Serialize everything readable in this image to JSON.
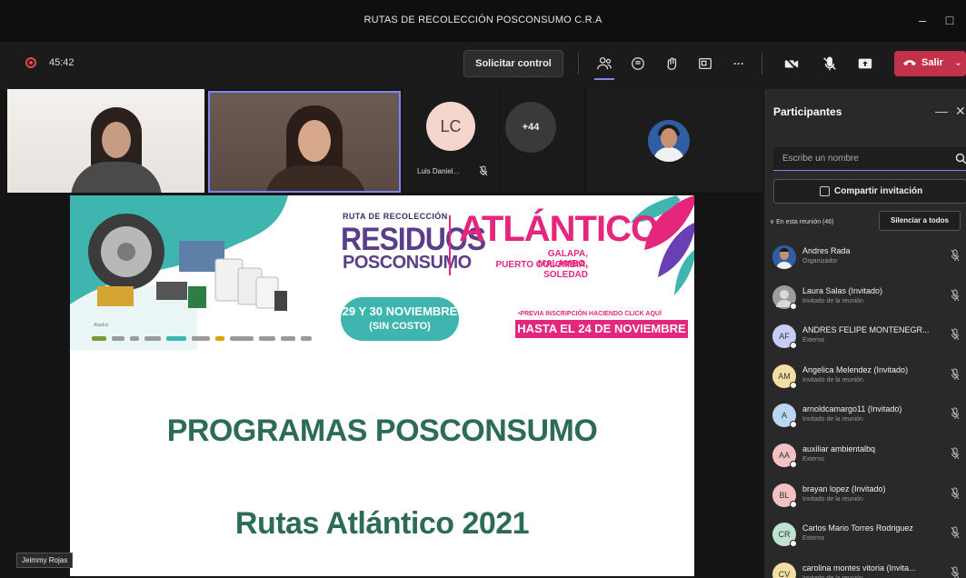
{
  "window": {
    "title": "RUTAS DE RECOLECCIÓN POSCONSUMO C.R.A",
    "minimize": "–",
    "maximize": "□"
  },
  "toolbar": {
    "timer": "45:42",
    "request_control_label": "Solicitar control",
    "more_label": "···",
    "leave_label": "Salir"
  },
  "tiles": {
    "lc_initials": "LC",
    "lc_name": "Luis Daniel...",
    "overflow_count": "+44"
  },
  "slide": {
    "ruta_label": "RUTA DE RECOLECCIÓN",
    "residuos": "RESIDUOS",
    "posconsumo": "POSCONSUMO",
    "atlantico": "ATLÁNTICO",
    "places_line1": "GALAPA, MALAMBO,",
    "places_line2": "PUERTO COLOMBIA, SOLEDAD",
    "dates_line1": "29 Y 30 NOVIEMBRE",
    "dates_line2": "(SIN COSTO)",
    "pre_note": "•PREVIA INSCRIPCIÓN HACIENDO CLICK AQUÍ",
    "deadline": "HASTA EL 24 DE NOVIEMBRE",
    "sponsors_label": "Aliados",
    "title": "PROGRAMAS POSCONSUMO",
    "subtitle": "Rutas Atlántico 2021"
  },
  "presenter_tag": "Jeimmy Rojas",
  "panel": {
    "title": "Participantes",
    "search_placeholder": "Escribe un nombre",
    "share_label": "Compartir invitación",
    "section_label": "∨ En esta reunión (46)",
    "mute_all_label": "Silenciar a todos",
    "participants": [
      {
        "name": "Andres Rada",
        "role": "Organizador",
        "initials": "",
        "avatar_color": "#2e5fa5",
        "photo": true
      },
      {
        "name": "Laura Salas (Invitado)",
        "role": "Invitado de la reunión",
        "initials": "",
        "avatar_color": "#9c9c9c",
        "photo": false
      },
      {
        "name": "ANDRES FELIPE MONTENEGR...",
        "role": "Externo",
        "initials": "AF",
        "avatar_color": "#c9cdf5"
      },
      {
        "name": "Angelica Melendez (Invitado)",
        "role": "Invitado de la reunión",
        "initials": "AM",
        "avatar_color": "#f3dfa2"
      },
      {
        "name": "arnoldcamargo11 (Invitado)",
        "role": "Invitado de la reunión",
        "initials": "A",
        "avatar_color": "#bcd6f0"
      },
      {
        "name": "auxiliar ambientalbq",
        "role": "Externo",
        "initials": "AA",
        "avatar_color": "#f2c2c2"
      },
      {
        "name": "brayan lopez (Invitado)",
        "role": "Invitado de la reunión",
        "initials": "BL",
        "avatar_color": "#f2c2c2"
      },
      {
        "name": "Carlos Mario Torres Rodriguez",
        "role": "Externo",
        "initials": "CR",
        "avatar_color": "#bfe3d3"
      },
      {
        "name": "carolina montes vitoria (Invita...",
        "role": "Invitado de la reunión",
        "initials": "CV",
        "avatar_color": "#f3dfa2"
      }
    ]
  }
}
